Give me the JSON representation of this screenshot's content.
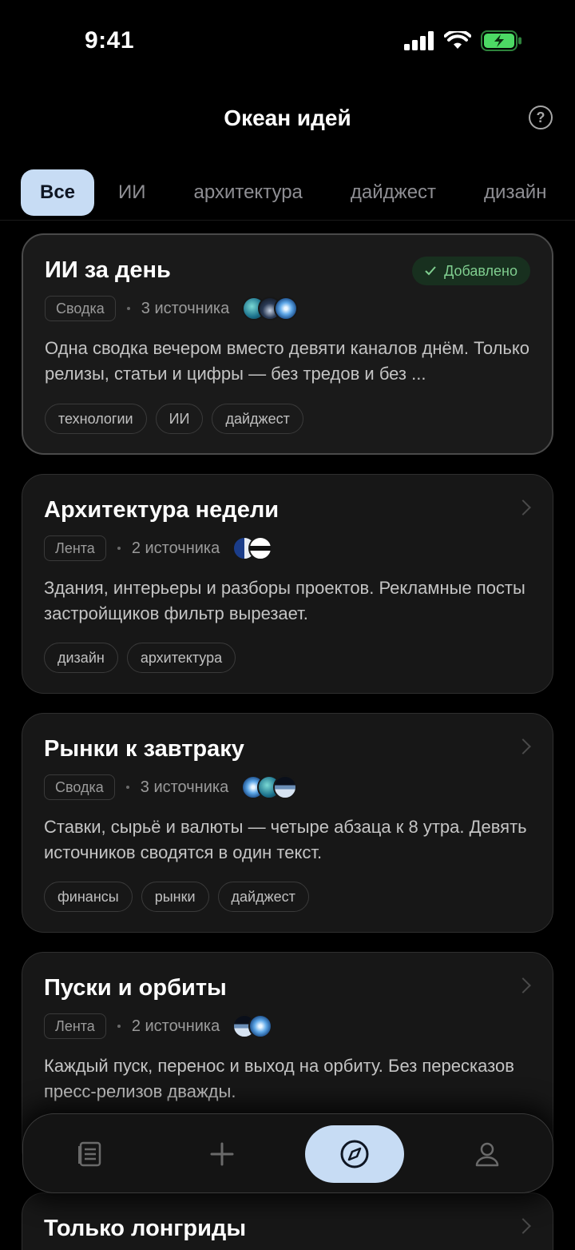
{
  "status": {
    "time": "9:41"
  },
  "header": {
    "title": "Океан идей",
    "help_label": "?"
  },
  "tabs": [
    {
      "label": "Все",
      "active": true
    },
    {
      "label": "ИИ"
    },
    {
      "label": "архитектура"
    },
    {
      "label": "дайджест"
    },
    {
      "label": "дизайн"
    }
  ],
  "cards": [
    {
      "title": "ИИ за день",
      "badge": "Добавлено",
      "type": "Сводка",
      "sources": "3 источника",
      "avatars": [
        "av-teal",
        "av-dark",
        "av-star"
      ],
      "description": "Одна сводка вечером вместо девяти каналов днём. Только релизы, статьи и цифры — без тредов и без ...",
      "tags": [
        "технологии",
        "ИИ",
        "дайджест"
      ]
    },
    {
      "title": "Архитектура недели",
      "type": "Лента",
      "sources": "2 источника",
      "avatars": [
        "av-split",
        "av-flag"
      ],
      "description": "Здания, интерьеры и разборы проектов. Рекламные посты застройщиков фильтр вырезает.",
      "tags": [
        "дизайн",
        "архитектура"
      ]
    },
    {
      "title": "Рынки к завтраку",
      "type": "Сводка",
      "sources": "3 источника",
      "avatars": [
        "av-star",
        "av-teal",
        "av-earth"
      ],
      "description": "Ставки, сырьё и валюты — четыре абзаца к 8 утра. Девять источников сводятся в один текст.",
      "tags": [
        "финансы",
        "рынки",
        "дайджест"
      ]
    },
    {
      "title": "Пуски и орбиты",
      "type": "Лента",
      "sources": "2 источника",
      "avatars": [
        "av-earth",
        "av-star"
      ],
      "description": "Каждый пуск, перенос и выход на орбиту. Без пересказов пресс-релизов дважды.",
      "tags": []
    },
    {
      "title": "Только лонгриды",
      "type": "",
      "sources": "",
      "avatars": [],
      "description": "",
      "tags": []
    }
  ],
  "nav": {
    "items": [
      {
        "name": "feed",
        "icon": "list-icon"
      },
      {
        "name": "add",
        "icon": "plus-icon"
      },
      {
        "name": "explore",
        "icon": "compass-icon",
        "active": true
      },
      {
        "name": "profile",
        "icon": "person-icon"
      }
    ]
  },
  "colors": {
    "accent": "#c7dcf4",
    "added": "#7fce8f"
  }
}
